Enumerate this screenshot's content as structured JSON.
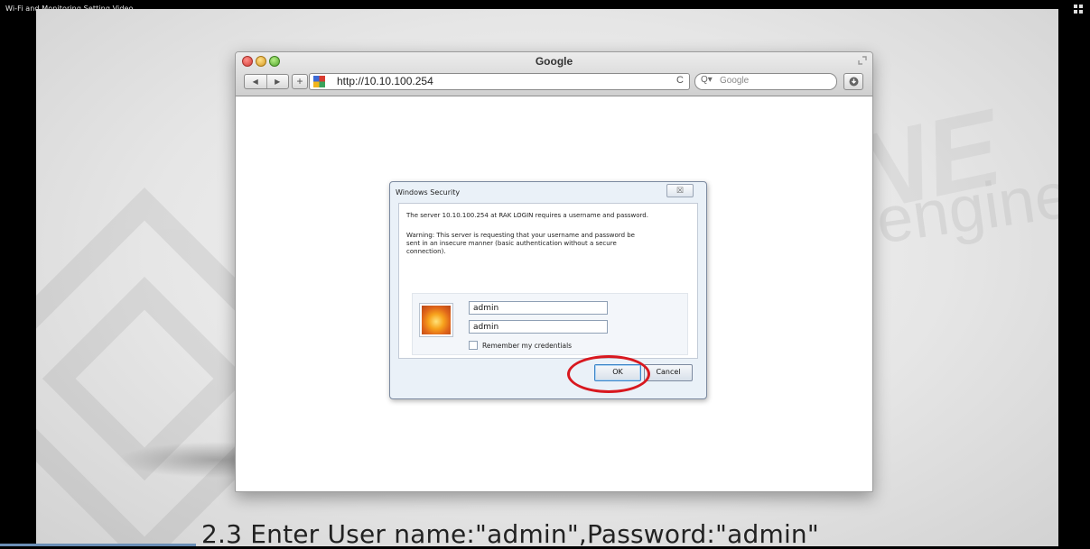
{
  "video": {
    "title": "Wi-Fi and Monitoring Setting Video",
    "caption": "2.3 Enter User name:\"admin\",Password:\"admin\"",
    "progress_fraction": 0.18
  },
  "browser": {
    "window_title": "Google",
    "url": "http://10.10.100.254",
    "search_placeholder": "Google",
    "nav_back_icon": "◀",
    "nav_forward_icon": "▶",
    "add_icon": "+",
    "reload_icon": "C"
  },
  "dialog": {
    "title": "Windows Security",
    "close_icon": "☒",
    "message": "The server 10.10.100.254 at RAK LOGIN requires a username and password.",
    "warning_line1": "Warning: This server is requesting that your username and password be",
    "warning_line2": "sent in an insecure manner (basic authentication without a secure",
    "warning_line3": "connection).",
    "username_value": "admin",
    "password_value": "admin",
    "remember_label": "Remember my credentials",
    "ok_label": "OK",
    "cancel_label": "Cancel"
  },
  "colors": {
    "highlight_circle": "#d8181f",
    "progress": "#6b8fb7"
  }
}
